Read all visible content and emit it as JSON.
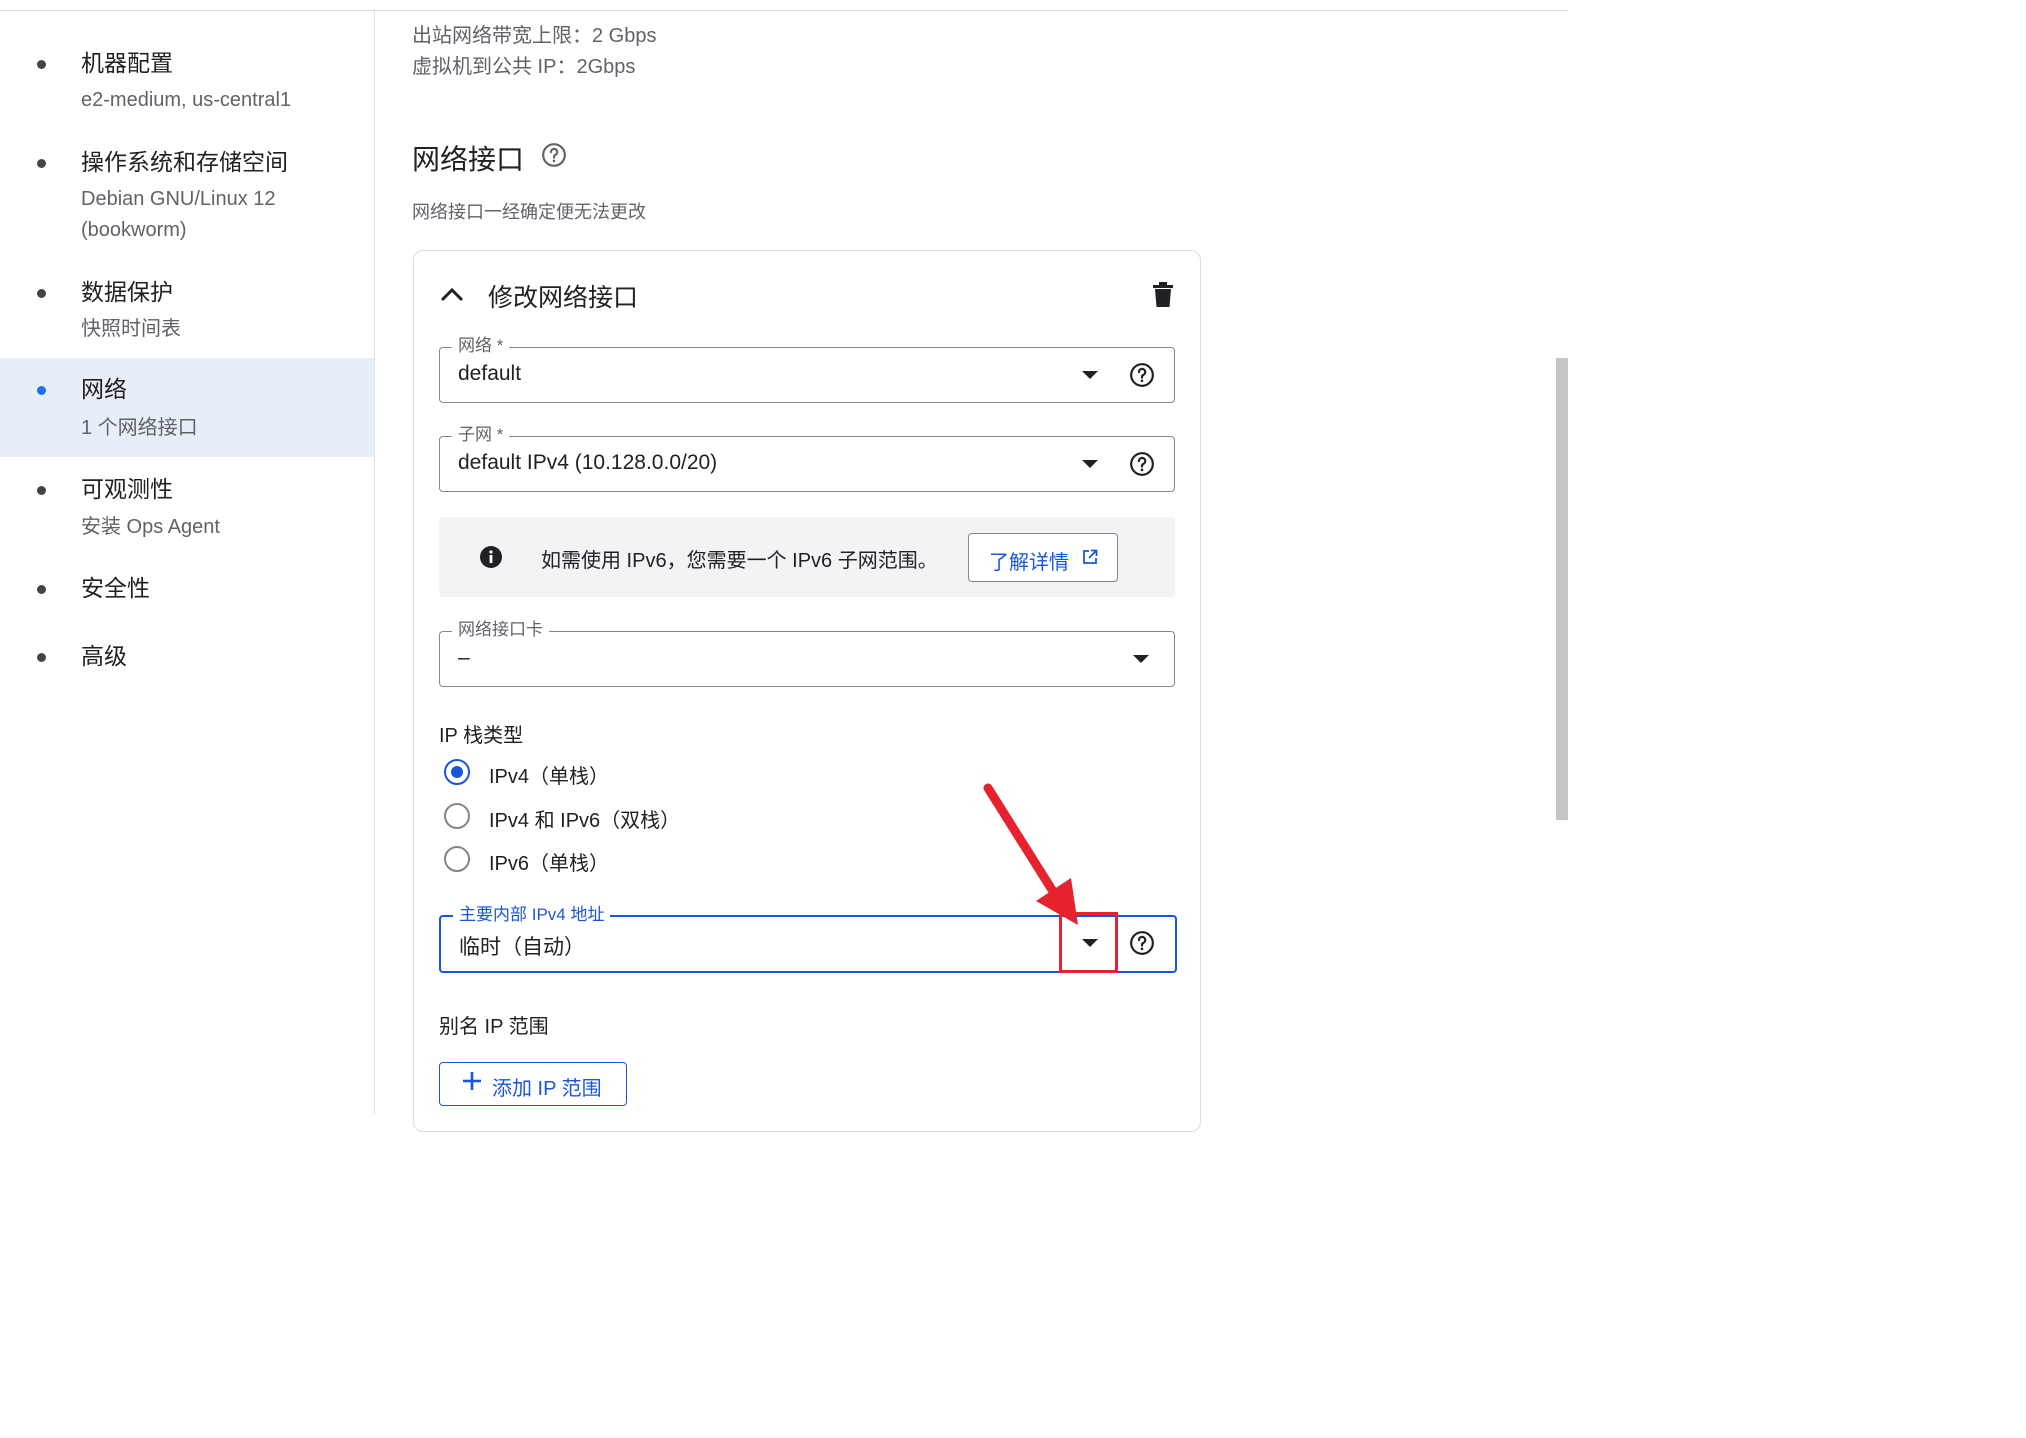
{
  "sidebar": {
    "items": [
      {
        "title": "机器配置",
        "subtitle": "e2-medium, us-central1",
        "active": false
      },
      {
        "title": "操作系统和存储空间",
        "subtitle": "Debian GNU/Linux 12 (bookworm)",
        "active": false
      },
      {
        "title": "数据保护",
        "subtitle": "快照时间表",
        "active": false
      },
      {
        "title": "网络",
        "subtitle": "1 个网络接口",
        "active": true
      },
      {
        "title": "可观测性",
        "subtitle": "安装 Ops Agent",
        "active": false
      },
      {
        "title": "安全性",
        "subtitle": "",
        "active": false
      },
      {
        "title": "高级",
        "subtitle": "",
        "active": false
      }
    ]
  },
  "bandwidth": {
    "egress": "出站网络带宽上限：2 Gbps",
    "vm_to_public": "虚拟机到公共 IP：2Gbps"
  },
  "network_interfaces": {
    "title": "网络接口",
    "description": "网络接口一经确定便无法更改",
    "card_title": "修改网络接口",
    "network": {
      "label": "网络 *",
      "value": "default"
    },
    "subnet": {
      "label": "子网 *",
      "value": "default IPv4 (10.128.0.0/20)"
    },
    "info": {
      "text": "如需使用 IPv6，您需要一个 IPv6 子网范围。",
      "link_label": "了解详情"
    },
    "nic": {
      "label": "网络接口卡",
      "value": "–"
    },
    "ip_stack": {
      "label": "IP 栈类型",
      "options": [
        "IPv4（单栈）",
        "IPv4 和 IPv6（双栈）",
        "IPv6（单栈）"
      ],
      "selected": "IPv4（单栈）"
    },
    "primary_ipv4": {
      "label": "主要内部 IPv4 地址",
      "value": "临时（自动）"
    },
    "alias": {
      "label": "别名 IP 范围",
      "add_button": "添加 IP 范围"
    }
  },
  "colors": {
    "accent": "#1a56db",
    "annotation_red": "#e5222e",
    "active_nav_bg": "#e8eef7"
  }
}
